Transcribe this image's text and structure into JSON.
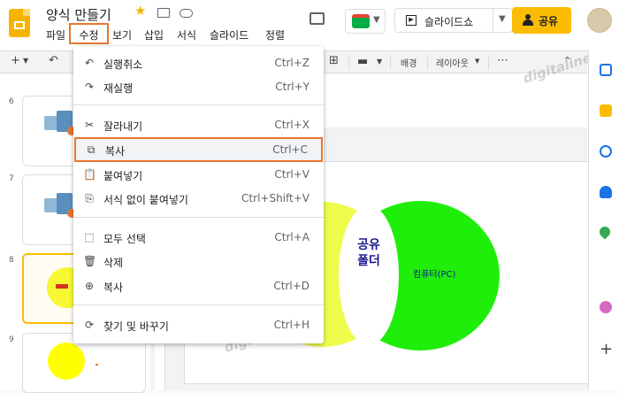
{
  "header": {
    "title": "양식 만들기",
    "icons": [
      "star-icon",
      "move-to-folder-icon",
      "cloud-saved-icon"
    ],
    "menu": [
      "파일",
      "수정",
      "보기",
      "삽입",
      "서식",
      "슬라이드",
      "정렬"
    ],
    "slideshow_label": "슬라이드쇼",
    "share_label": "공유"
  },
  "toolbar": {
    "background_label": "배경",
    "layout_label": "레이아웃",
    "more_label": "⋯"
  },
  "filmstrip": {
    "slide_numbers": [
      "6",
      "7",
      "8",
      "9"
    ],
    "selected_slide": "8"
  },
  "slide": {
    "shared_folder_label": "공유폴더",
    "computer_label": "컴퓨터(PC)",
    "colors": {
      "left_circle": "#eefc4d",
      "right_circle": "#1fee0a",
      "label_text": "#1a1a8c"
    }
  },
  "watermark": "digitaline",
  "edit_menu": {
    "items": [
      {
        "label": "실행취소",
        "shortcut": "Ctrl+Z",
        "icon": "undo-icon"
      },
      {
        "label": "재실행",
        "shortcut": "Ctrl+Y",
        "icon": "redo-icon"
      },
      {
        "label": "잘라내기",
        "shortcut": "Ctrl+X",
        "icon": "cut-icon"
      },
      {
        "label": "복사",
        "shortcut": "Ctrl+C",
        "icon": "copy-icon",
        "highlighted": true
      },
      {
        "label": "붙여넣기",
        "shortcut": "Ctrl+V",
        "icon": "paste-icon"
      },
      {
        "label": "서식 없이 붙여넣기",
        "shortcut": "Ctrl+Shift+V",
        "icon": "paste-plain-icon"
      },
      {
        "label": "모두 선택",
        "shortcut": "Ctrl+A",
        "icon": "select-all-icon"
      },
      {
        "label": "삭제",
        "shortcut": "",
        "icon": "delete-icon"
      },
      {
        "label": "복사",
        "shortcut": "Ctrl+D",
        "icon": "duplicate-icon"
      },
      {
        "label": "찾기 및 바꾸기",
        "shortcut": "Ctrl+H",
        "icon": "find-replace-icon"
      }
    ]
  },
  "colors": {
    "accent_highlight": "#e8772c",
    "share_button": "#fbbc04",
    "selected_thumb": "#fbbc04"
  }
}
